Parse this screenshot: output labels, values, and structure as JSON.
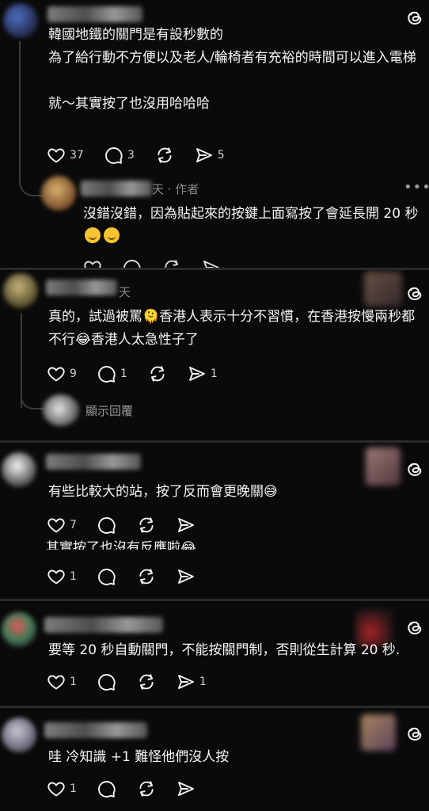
{
  "threads_icon": "threads-logo-icon",
  "posts": [
    {
      "text": "韓國地鐵的關門是有設秒數的\n為了給行動不方便以及老人/輪椅者有充裕的時間可以進入電梯\n\n就～其實按了也沒用哈哈哈",
      "like_count": "37",
      "reply_count": "3",
      "share_count": "5"
    },
    {
      "author_suffix": "天 · 作者",
      "text": "沒錯沒錯，因為貼起來的按鍵上面寫按了會延長開 20 秒",
      "emoji": "😆 😆"
    },
    {
      "author_suffix": "天",
      "text": "真的，試過被罵🫠香港人表示十分不習慣，在香港按慢兩秒都不行😂香港人太急性子了",
      "like_count": "9",
      "reply_count": "1",
      "share_count": "1",
      "show_replies": "顯示回覆"
    },
    {
      "text": "有些比較大的站，按了反而會更晚關😅",
      "like_count": "7",
      "overflow_text": "其實按了也沒有反應啦😂",
      "overflow_like_count": "1"
    },
    {
      "text": "要等 20 秒自動關門，不能按關門制，否則從生計算 20 秒.",
      "like_count": "1",
      "share_count": "1"
    },
    {
      "text": "哇 冷知識 +1 難怪他們沒人按",
      "like_count": "1"
    }
  ]
}
